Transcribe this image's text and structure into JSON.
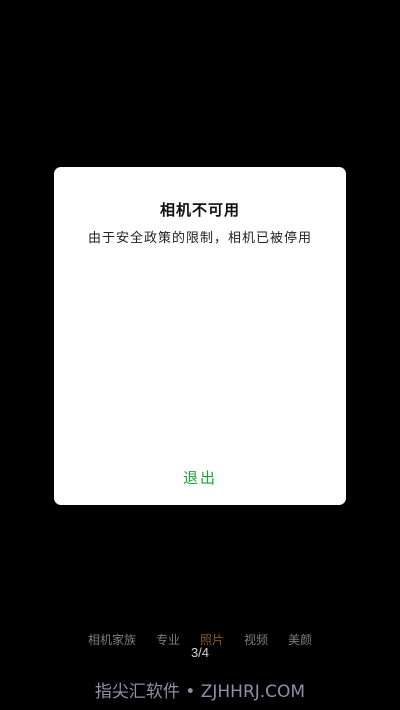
{
  "dialog": {
    "title": "相机不可用",
    "message": "由于安全政策的限制，相机已被停用",
    "exit_label": "退出",
    "exit_color": "#1fa33a"
  },
  "modes": {
    "items": [
      {
        "label": "相机家族"
      },
      {
        "label": "专业"
      },
      {
        "label": "照片"
      },
      {
        "label": "视频"
      },
      {
        "label": "美颜"
      }
    ],
    "active_index": 2,
    "active_color": "#8a5a16"
  },
  "pager": {
    "text": "3/4"
  },
  "watermark": {
    "text": "指尖汇软件 • ZJHHRJ.COM"
  }
}
